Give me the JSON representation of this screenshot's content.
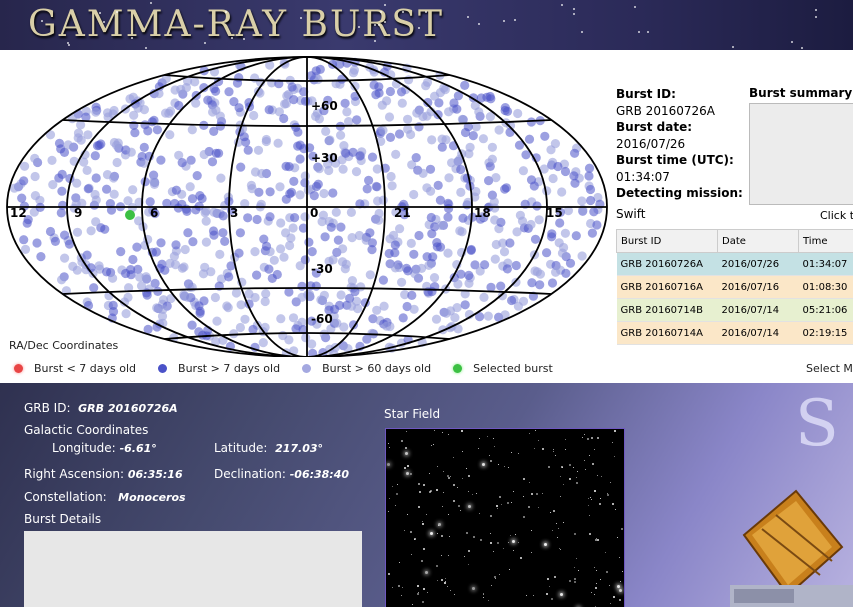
{
  "banner": {
    "title": "GAMMA-RAY BURST"
  },
  "map": {
    "caption": "RA/Dec Coordinates",
    "lat_labels": [
      "+60",
      "+30",
      "-30",
      "-60"
    ],
    "lon_labels": [
      "12",
      "9",
      "6",
      "3",
      "0",
      "21",
      "18",
      "15"
    ],
    "colors": {
      "recent": "#e84545",
      "older": "#4a52c8",
      "oldest": "#9aa0dc",
      "selected": "#3cc043",
      "grid": "#000000"
    }
  },
  "legend": [
    {
      "label": "Burst < 7 days old",
      "color": "#e84545"
    },
    {
      "label": "Burst > 7 days old",
      "color": "#4a52c8"
    },
    {
      "label": "Burst > 60 days old",
      "color": "#a4a8e0"
    },
    {
      "label": "Selected burst",
      "color": "#3cc043"
    }
  ],
  "select_mission_label": "Select M",
  "info": {
    "burst_id_label": "Burst ID:",
    "burst_id": "GRB 20160726A",
    "burst_date_label": "Burst date:",
    "burst_date": "2016/07/26",
    "burst_time_label": "Burst time (UTC):",
    "burst_time": "01:34:07",
    "mission_label": "Detecting mission:",
    "mission": "Swift",
    "summary_label": "Burst summary",
    "click_hint": "Click t"
  },
  "table": {
    "headers": [
      "Burst ID",
      "Date",
      "Time"
    ],
    "rows": [
      [
        "GRB 20160726A",
        "2016/07/26",
        "01:34:07"
      ],
      [
        "GRB 20160716A",
        "2016/07/16",
        "01:08:30"
      ],
      [
        "GRB 20160714B",
        "2016/07/14",
        "05:21:06"
      ],
      [
        "GRB 20160714A",
        "2016/07/14",
        "02:19:15"
      ]
    ]
  },
  "detail": {
    "grb_id_label": "GRB ID:",
    "grb_id": "GRB 20160726A",
    "galactic_label": "Galactic Coordinates",
    "longitude_label": "Longitude:",
    "longitude": "-6.61°",
    "latitude_label": "Latitude:",
    "latitude": "217.03°",
    "ra_label": "Right Ascension:",
    "ra": "06:35:16",
    "dec_label": "Declination:",
    "dec": "-06:38:40",
    "constellation_label": "Constellation:",
    "constellation": "Monoceros",
    "burst_details_label": "Burst Details",
    "star_field_label": "Star Field",
    "big_letter": "S"
  }
}
